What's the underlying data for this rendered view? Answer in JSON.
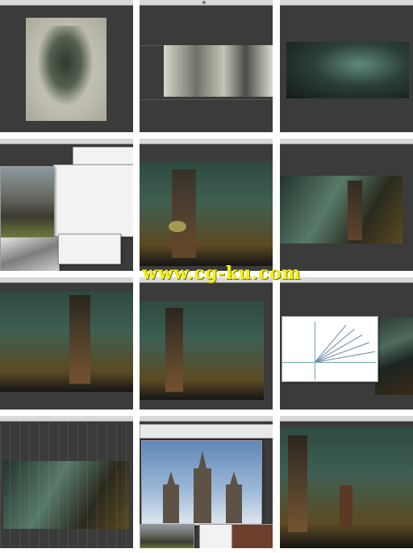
{
  "watermark": {
    "text": "www.cg-ku.com"
  },
  "colors": {
    "canvas_bg": "#3b3b3b",
    "watermark": "#f4f01c",
    "divider": "#ffffff"
  },
  "panels": [
    {
      "id": 1,
      "content": "ink-sketch-portrait"
    },
    {
      "id": 2,
      "content": "ink-sketch-wide"
    },
    {
      "id": 3,
      "content": "teal-painting-wide"
    },
    {
      "id": 4,
      "content": "reference-photos-collage"
    },
    {
      "id": 5,
      "content": "tower-painting"
    },
    {
      "id": 6,
      "content": "tower-painting-zoomed-out"
    },
    {
      "id": 7,
      "content": "tower-painting-detail"
    },
    {
      "id": 8,
      "content": "tower-painting-detail-2"
    },
    {
      "id": 9,
      "content": "perspective-guide-window"
    },
    {
      "id": 10,
      "content": "painting-with-grid"
    },
    {
      "id": 11,
      "content": "cathedral-photo-reference"
    },
    {
      "id": 12,
      "content": "final-painting"
    }
  ]
}
